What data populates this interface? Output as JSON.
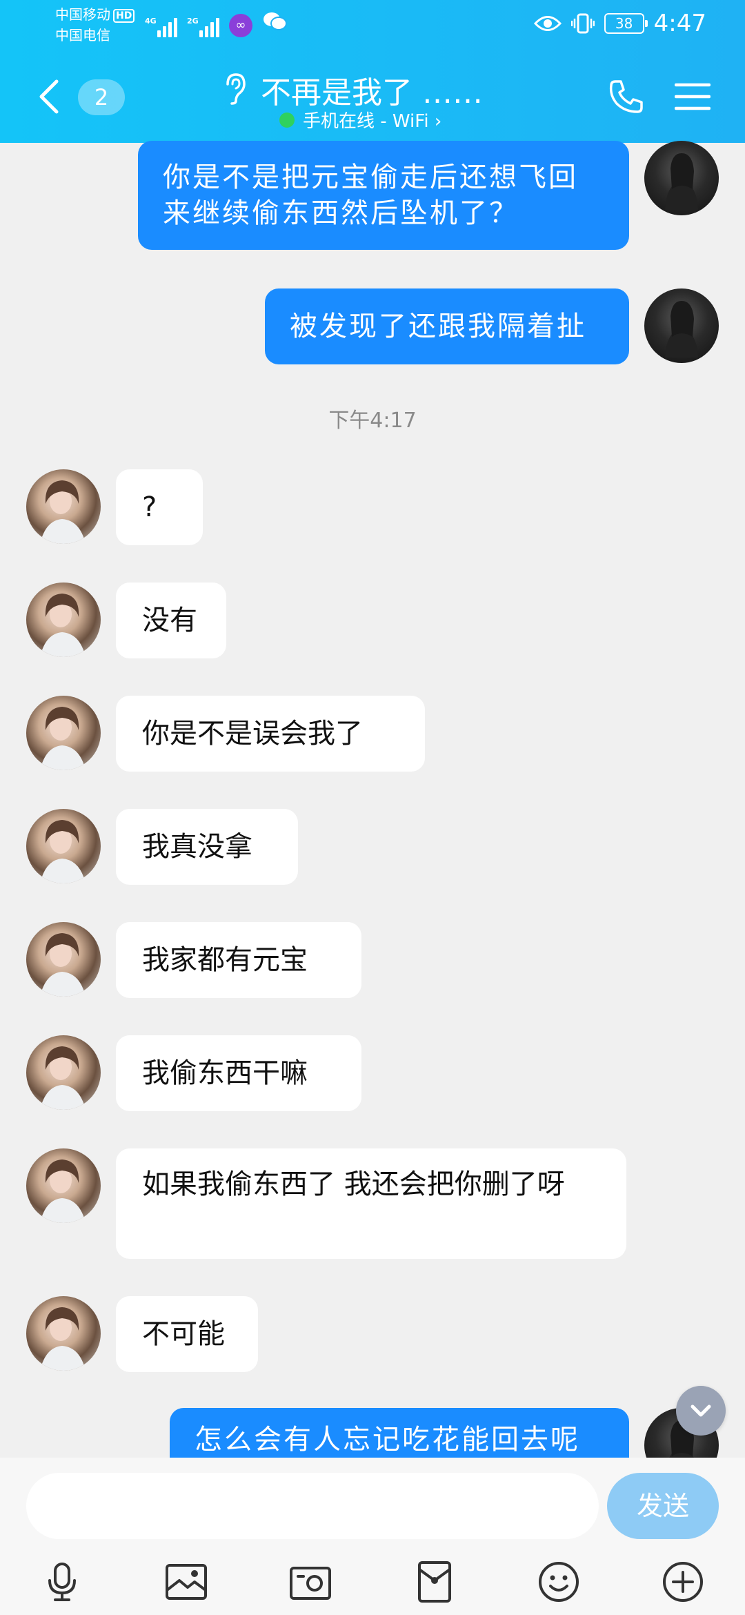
{
  "status_bar": {
    "carrier1": "中国移动",
    "carrier1_badge": "HD",
    "carrier2": "中国电信",
    "net1": "4G",
    "net2": "2G",
    "battery": "38",
    "time": "4:47"
  },
  "header": {
    "unread_count": "2",
    "title": "不再是我了 ……",
    "online_status": "手机在线 - WiFi ›"
  },
  "messages": {
    "m1": "你是不是把元宝偷走后还想飞回来继续偷东西然后坠机了？",
    "m2": "被发现了还跟我隔着扯",
    "timestamp": "下午4:17",
    "r1": "?",
    "r2": "没有",
    "r3": "你是不是误会我了",
    "r4": "我真没拿",
    "r5": "我家都有元宝",
    "r6": "我偷东西干嘛",
    "r7": "如果我偷东西了 我还会把你删了呀",
    "r8": "不可能",
    "m3": "怎么会有人忘记吃花能回去呢"
  },
  "input": {
    "send_label": "发送"
  },
  "colors": {
    "header": "#1fb2f4",
    "outgoing_bubble": "#1a8cff",
    "incoming_bubble": "#ffffff",
    "background": "#f0f0f0",
    "send_button": "#8ecbf5"
  },
  "icons": [
    "back-icon",
    "ear-icon",
    "phone-icon",
    "menu-icon",
    "scroll-down-icon",
    "mic-icon",
    "image-icon",
    "camera-icon",
    "red-packet-icon",
    "emoji-icon",
    "plus-icon"
  ]
}
